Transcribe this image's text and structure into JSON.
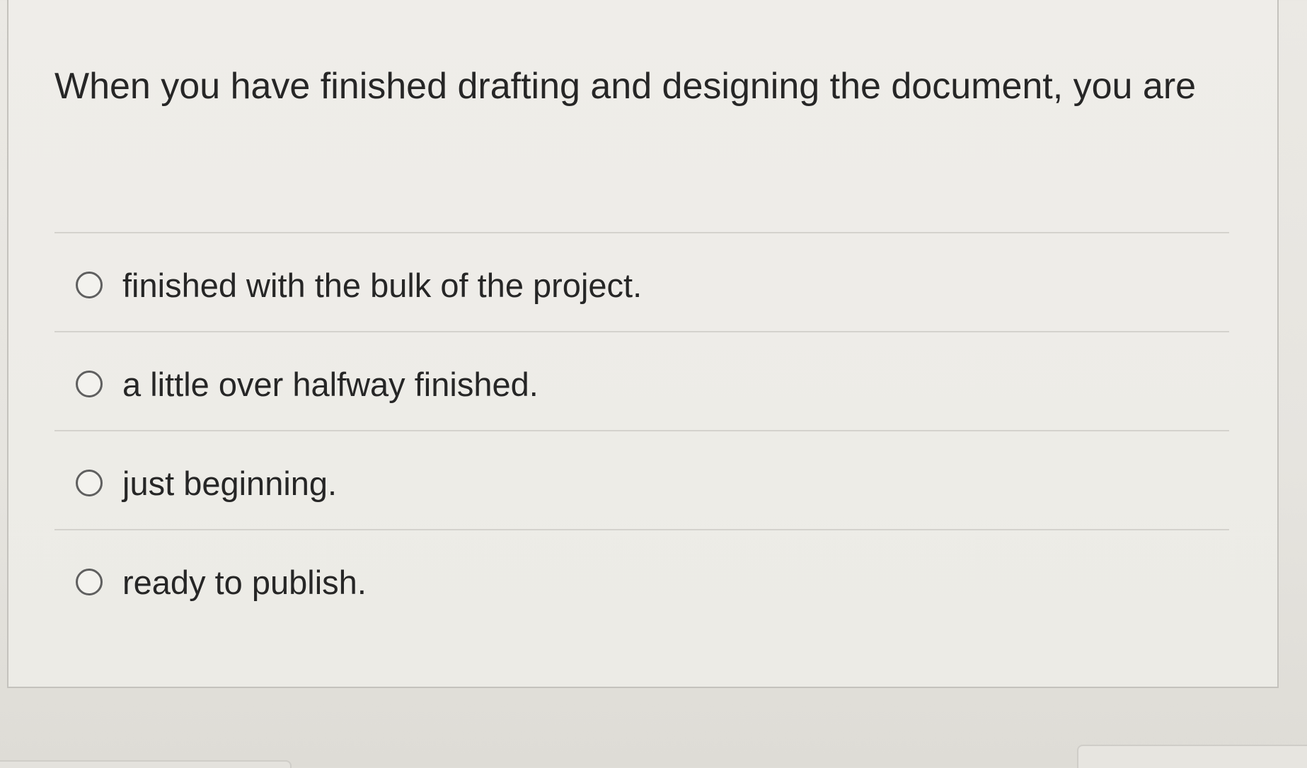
{
  "question": {
    "text": "When you have finished drafting and designing the document, you are"
  },
  "options": [
    {
      "label": "finished with the bulk of the project.",
      "selected": false
    },
    {
      "label": "a little over halfway finished.",
      "selected": false
    },
    {
      "label": "just beginning.",
      "selected": false
    },
    {
      "label": "ready to publish.",
      "selected": false
    }
  ],
  "colors": {
    "background": "#e9e7e2",
    "card_border": "#c4c2bd",
    "text": "#262626",
    "radio_border": "#5f5f5f"
  }
}
